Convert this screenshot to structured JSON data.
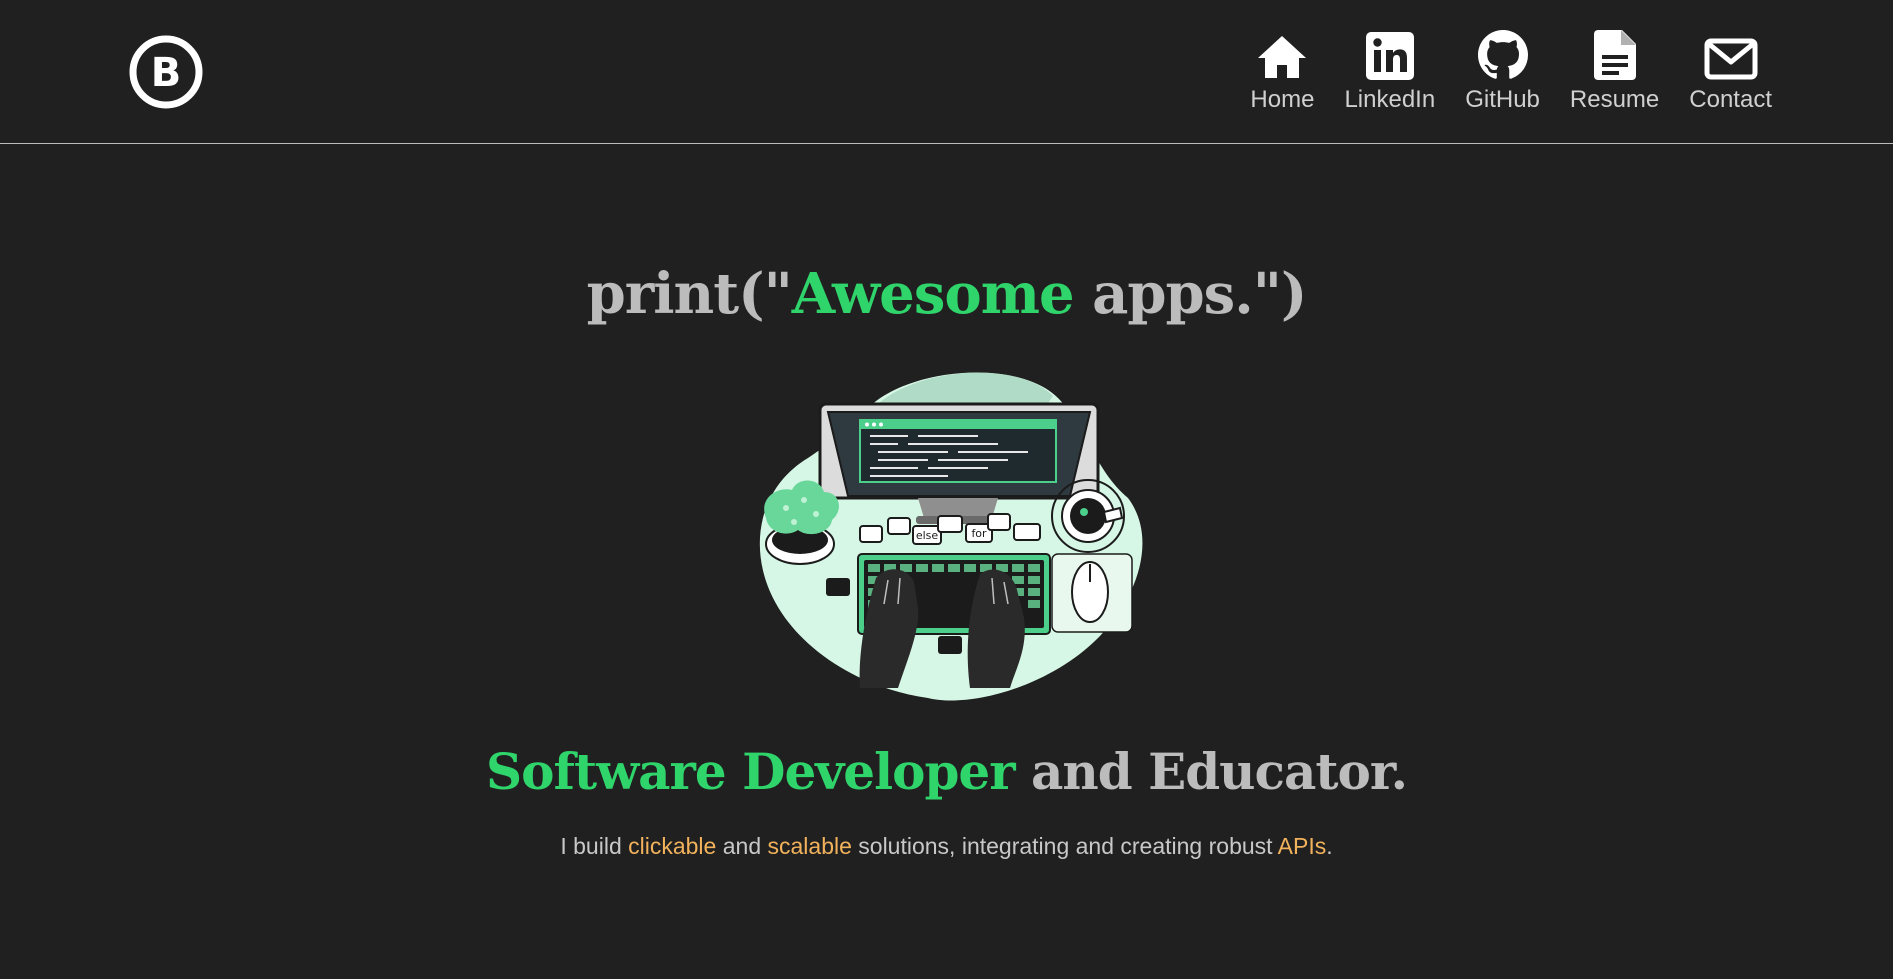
{
  "header": {
    "logo_letter": "B",
    "nav": [
      {
        "label": "Home",
        "icon": "home-icon"
      },
      {
        "label": "LinkedIn",
        "icon": "linkedin-icon"
      },
      {
        "label": "GitHub",
        "icon": "github-icon"
      },
      {
        "label": "Resume",
        "icon": "document-icon"
      },
      {
        "label": "Contact",
        "icon": "mail-icon"
      }
    ]
  },
  "hero": {
    "title_prefix": "print(\"",
    "title_highlight": "Awesome",
    "title_suffix": " apps.\")",
    "illustration_keywords": [
      "else",
      "for"
    ],
    "tagline_highlight": "Software Developer",
    "tagline_rest": " and Educator.",
    "subtitle": {
      "p1": "I build ",
      "h1": "clickable",
      "p2": " and ",
      "h2": "scalable",
      "p3": " solutions, integrating and creating robust ",
      "h3": "APIs",
      "p4": "."
    }
  },
  "colors": {
    "background": "#202020",
    "accent_green": "#2fd46b",
    "accent_orange": "#f2b25c",
    "text_gray": "#bcbcbc"
  }
}
